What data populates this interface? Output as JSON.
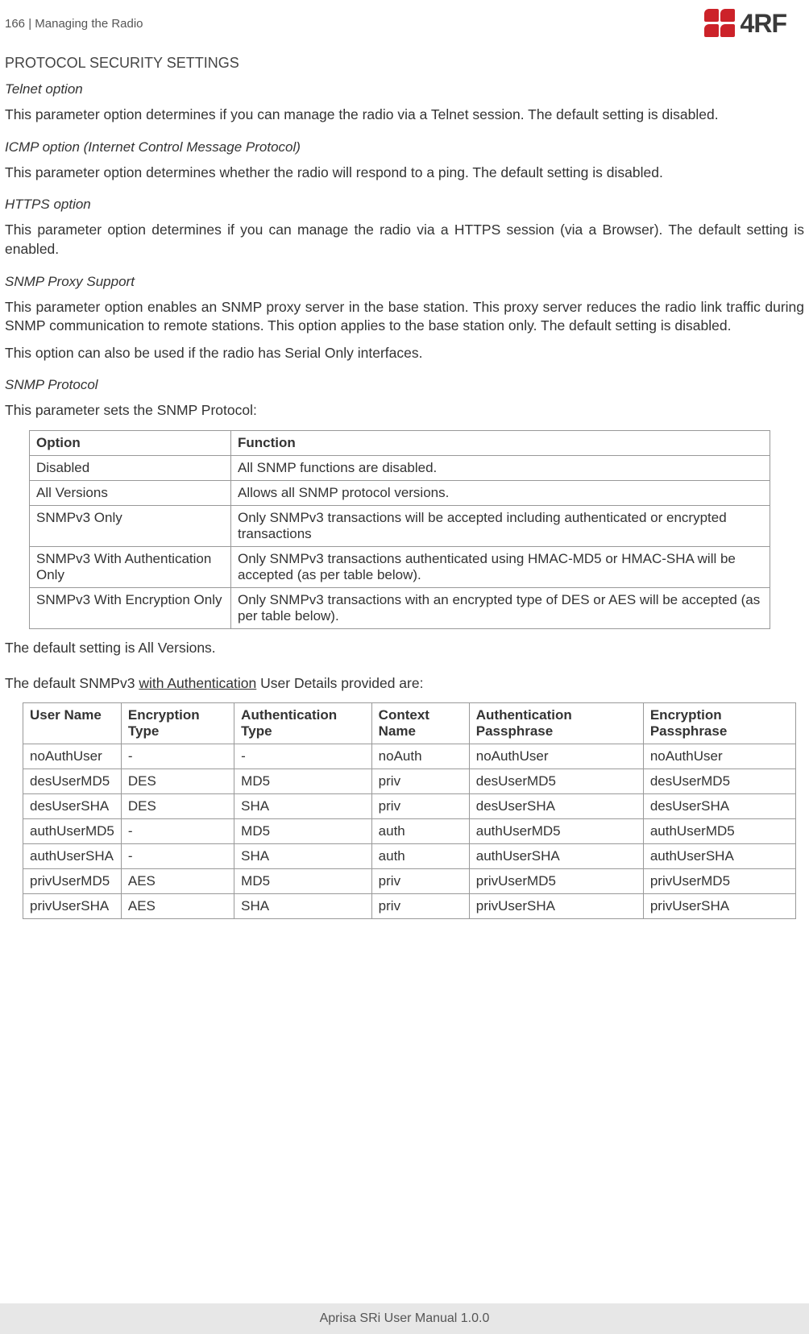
{
  "header": {
    "page_num": "166",
    "separator": " | ",
    "section": "Managing the Radio",
    "logo_text": "4RF"
  },
  "title": "PROTOCOL SECURITY SETTINGS",
  "telnet": {
    "heading": "Telnet option",
    "text": "This parameter option determines if you can manage the radio via a Telnet session. The default setting is disabled."
  },
  "icmp": {
    "heading": "ICMP option (Internet Control Message Protocol)",
    "text": "This parameter option determines whether the radio will respond to a ping. The default setting is disabled."
  },
  "https": {
    "heading": "HTTPS option",
    "text": "This parameter option determines if you can manage the radio via a HTTPS session (via a Browser). The default setting is enabled."
  },
  "snmp_proxy": {
    "heading": "SNMP Proxy Support",
    "text1": "This parameter option enables an SNMP proxy server in the base station. This proxy server reduces the radio link traffic during SNMP communication to remote stations. This option applies to the base station only. The default setting is disabled.",
    "text2": "This option can also be used if the radio has Serial Only interfaces."
  },
  "snmp_protocol": {
    "heading": "SNMP Protocol",
    "intro": "This parameter sets the SNMP Protocol:",
    "headers": {
      "col1": "Option",
      "col2": "Function"
    },
    "rows": [
      {
        "option": "Disabled",
        "function": "All SNMP functions are disabled."
      },
      {
        "option": "All Versions",
        "function": "Allows all SNMP protocol versions."
      },
      {
        "option": "SNMPv3 Only",
        "function": "Only SNMPv3 transactions will be accepted including authenticated or encrypted transactions"
      },
      {
        "option": "SNMPv3 With Authentication Only",
        "function": "Only SNMPv3 transactions authenticated using HMAC-MD5 or HMAC-SHA will be accepted (as per table below)."
      },
      {
        "option": "SNMPv3 With Encryption Only",
        "function": "Only SNMPv3 transactions with an encrypted type of DES or AES will be accepted (as per table below)."
      }
    ],
    "default": "The default setting is All Versions."
  },
  "user_details": {
    "intro_pre": "The default SNMPv3 ",
    "intro_link": "with Authentication",
    "intro_post": " User Details provided are:",
    "headers": {
      "c1": "User Name",
      "c2": "Encryption Type",
      "c3": "Authentication Type",
      "c4": "Context Name",
      "c5": "Authentication Passphrase",
      "c6": "Encryption Passphrase"
    },
    "rows": [
      {
        "c1": "noAuthUser",
        "c2": "-",
        "c3": "-",
        "c4": "noAuth",
        "c5": "noAuthUser",
        "c6": "noAuthUser"
      },
      {
        "c1": "desUserMD5",
        "c2": "DES",
        "c3": "MD5",
        "c4": "priv",
        "c5": "desUserMD5",
        "c6": "desUserMD5"
      },
      {
        "c1": "desUserSHA",
        "c2": "DES",
        "c3": "SHA",
        "c4": "priv",
        "c5": "desUserSHA",
        "c6": "desUserSHA"
      },
      {
        "c1": "authUserMD5",
        "c2": "-",
        "c3": "MD5",
        "c4": "auth",
        "c5": "authUserMD5",
        "c6": "authUserMD5"
      },
      {
        "c1": "authUserSHA",
        "c2": "-",
        "c3": "SHA",
        "c4": "auth",
        "c5": "authUserSHA",
        "c6": "authUserSHA"
      },
      {
        "c1": "privUserMD5",
        "c2": "AES",
        "c3": "MD5",
        "c4": "priv",
        "c5": "privUserMD5",
        "c6": "privUserMD5"
      },
      {
        "c1": "privUserSHA",
        "c2": "AES",
        "c3": "SHA",
        "c4": "priv",
        "c5": "privUserSHA",
        "c6": "privUserSHA"
      }
    ]
  },
  "footer": "Aprisa SRi User Manual 1.0.0"
}
